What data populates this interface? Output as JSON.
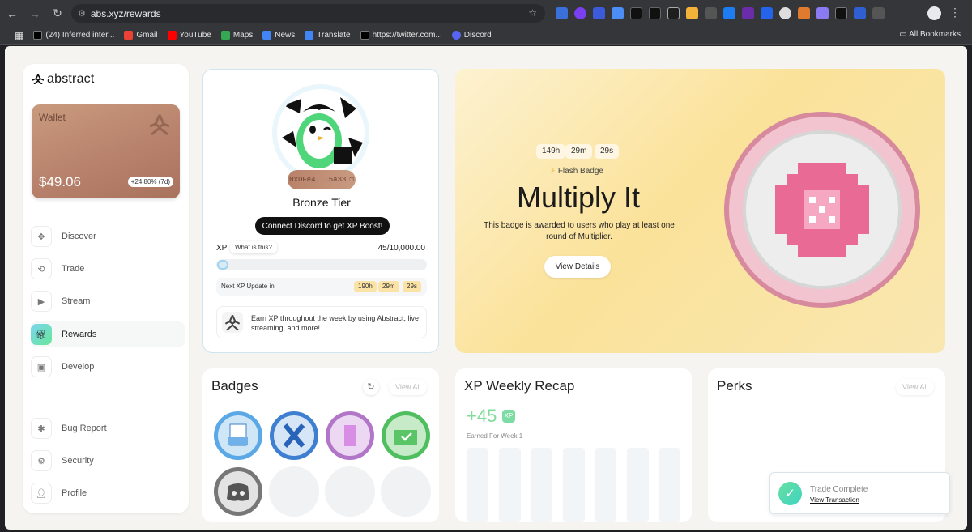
{
  "browser": {
    "url": "abs.xyz/rewards",
    "bookmarks": [
      {
        "label": "(24) Inferred inter...",
        "icon": "x-logo-icon",
        "color": "#000000"
      },
      {
        "label": "Gmail",
        "icon": "gmail-icon",
        "color": "#ea4335"
      },
      {
        "label": "YouTube",
        "icon": "youtube-icon",
        "color": "#ff0000"
      },
      {
        "label": "Maps",
        "icon": "maps-icon",
        "color": "#34a853"
      },
      {
        "label": "News",
        "icon": "news-icon",
        "color": "#4285f4"
      },
      {
        "label": "Translate",
        "icon": "translate-icon",
        "color": "#4285f4"
      },
      {
        "label": "https://twitter.com...",
        "icon": "x-logo-icon",
        "color": "#000000"
      },
      {
        "label": "Discord",
        "icon": "discord-icon",
        "color": "#5865f2"
      }
    ],
    "all_bookmarks": "All Bookmarks"
  },
  "sidebar": {
    "logo": "abstract",
    "wallet": {
      "label": "Wallet",
      "amount": "$49.06",
      "change": "+24.80% (7d)"
    },
    "items": [
      {
        "label": "Discover",
        "icon": "grid-icon"
      },
      {
        "label": "Trade",
        "icon": "swap-icon"
      },
      {
        "label": "Stream",
        "icon": "play-icon"
      },
      {
        "label": "Rewards",
        "icon": "gift-icon"
      },
      {
        "label": "Develop",
        "icon": "code-icon"
      },
      {
        "label": "Bug Report",
        "icon": "bug-icon"
      },
      {
        "label": "Security",
        "icon": "gear-icon"
      },
      {
        "label": "Profile",
        "icon": "user-icon"
      }
    ],
    "active": "Rewards"
  },
  "profile": {
    "address": "0xDFe4...5a33",
    "tier": "Bronze Tier",
    "discord_cta": "Connect Discord to get XP Boost!",
    "xp_label": "XP",
    "xp_help": "What is this?",
    "xp_value": "45/10,000.00",
    "xp_progress": 0.0045,
    "next_update_label": "Next XP Update in",
    "next_update": {
      "h": "190h",
      "m": "29m",
      "s": "29s"
    },
    "earn_text": "Earn XP throughout the week by using Abstract, live streaming, and more!"
  },
  "flash": {
    "timer": {
      "h": "149h",
      "m": "29m",
      "s": "29s"
    },
    "badge_label": "Flash Badge",
    "title": "Multiply It",
    "description": "This badge is awarded to users who play at least one round of Multiplier.",
    "button": "View Details"
  },
  "badges": {
    "title": "Badges",
    "view_all": "View All",
    "earned_count": 5
  },
  "recap": {
    "title": "XP Weekly Recap",
    "value": "+45",
    "xp_tag": "XP",
    "subtitle": "Earned For Week 1"
  },
  "perks": {
    "title": "Perks",
    "view_all": "View All"
  },
  "toast": {
    "title": "Trade Complete",
    "link": "View Transaction"
  },
  "colors": {
    "accent_green": "#7fdc9a",
    "flash_yellow": "#fbe29a",
    "wallet_copper": "#b6806a"
  }
}
